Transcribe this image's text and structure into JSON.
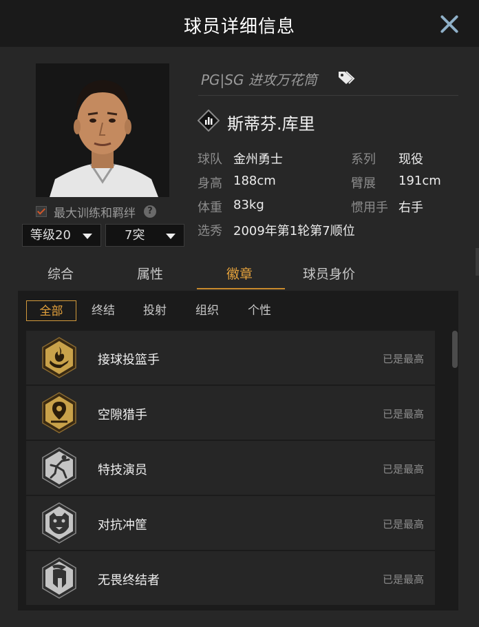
{
  "window": {
    "title": "球员详细信息"
  },
  "player": {
    "position_tag": "PG|SG 进攻万花筒",
    "name": "斯蒂芬.库里",
    "max_training_label": "最大训练和羁绊",
    "level_select": "等级20",
    "break_select": "7突",
    "info": [
      {
        "label": "球队",
        "value": "金州勇士"
      },
      {
        "label": "系列",
        "value": "现役"
      },
      {
        "label": "身高",
        "value": "188cm"
      },
      {
        "label": "臂展",
        "value": "191cm"
      },
      {
        "label": "体重",
        "value": "83kg"
      },
      {
        "label": "惯用手",
        "value": "右手"
      },
      {
        "label": "选秀",
        "value": "2009年第1轮第7顺位"
      }
    ]
  },
  "tabs": [
    "综合",
    "属性",
    "徽章",
    "球员身价"
  ],
  "active_tab": "徽章",
  "subtabs": [
    "全部",
    "终结",
    "投射",
    "组织",
    "个性"
  ],
  "active_subtab": "全部",
  "badges": [
    {
      "name": "接球投篮手",
      "status": "已是最高",
      "tier": "gold",
      "icon": "flame-hand-icon"
    },
    {
      "name": "空隙猎手",
      "status": "已是最高",
      "tier": "gold",
      "icon": "map-pin-icon"
    },
    {
      "name": "特技演员",
      "status": "已是最高",
      "tier": "silver",
      "icon": "acrobat-dunk-icon"
    },
    {
      "name": "对抗冲筐",
      "status": "已是最高",
      "tier": "silver",
      "icon": "bulldog-icon"
    },
    {
      "name": "无畏终结者",
      "status": "已是最高",
      "tier": "silver",
      "icon": "spartan-helmet-icon"
    }
  ],
  "colors": {
    "accent": "#e5a23c",
    "gold": "#c9a24a",
    "silver": "#c4c4c4"
  }
}
